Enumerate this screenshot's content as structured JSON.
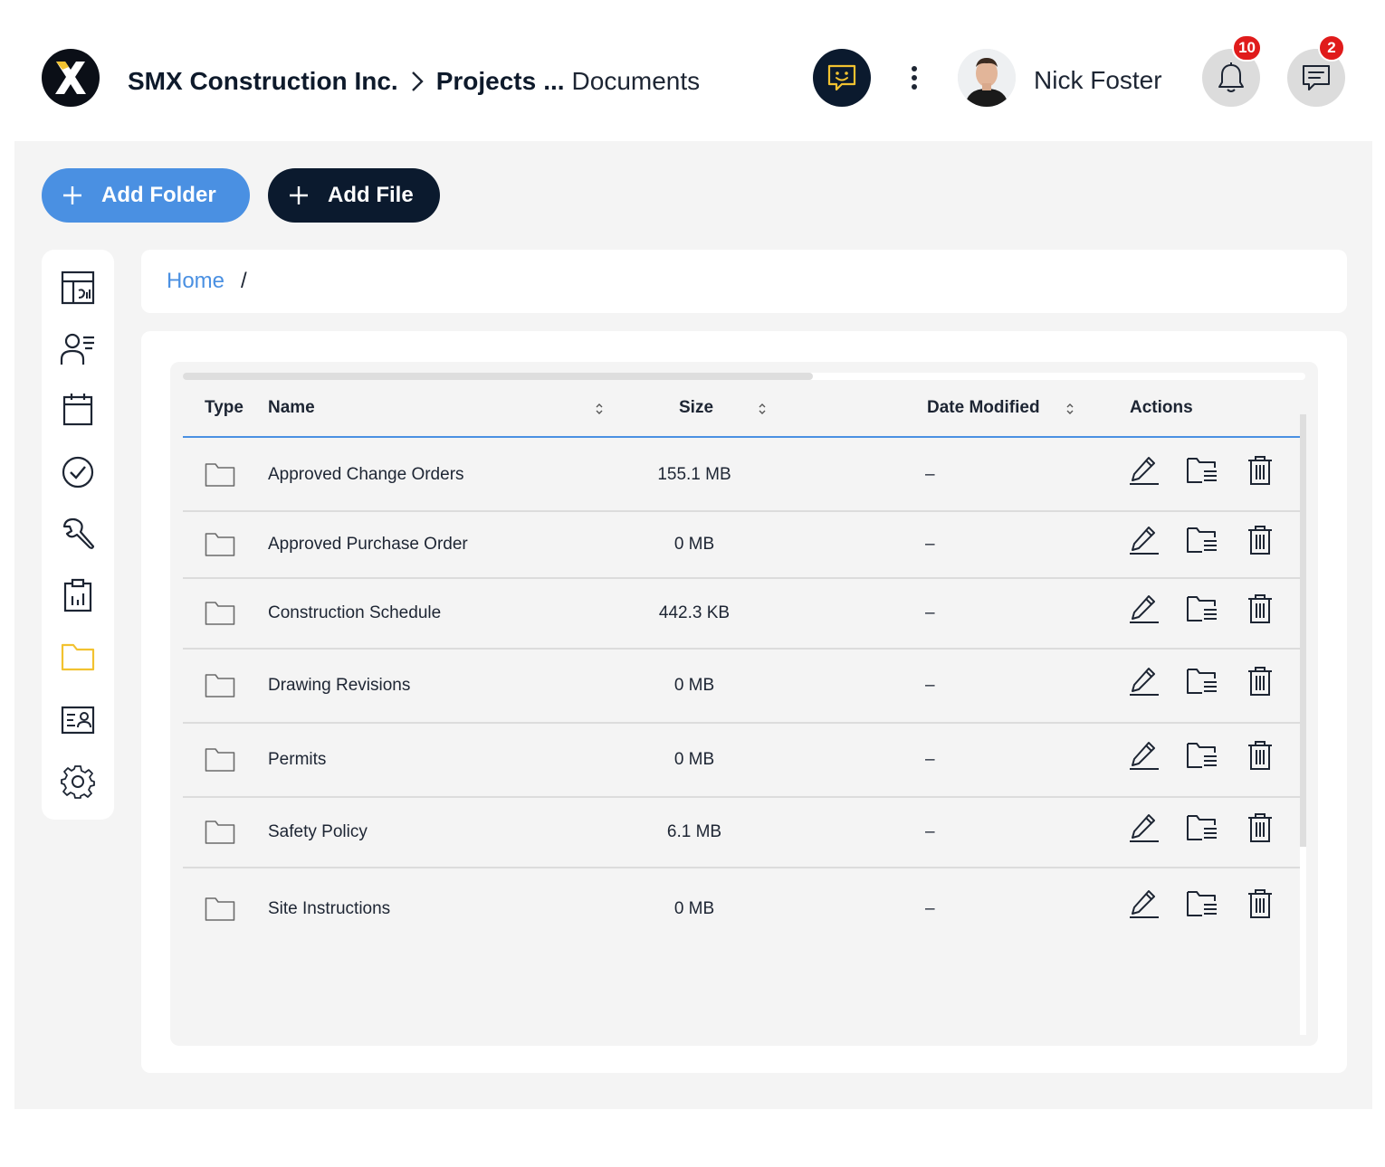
{
  "header": {
    "breadcrumb": {
      "company": "SMX Construction Inc.",
      "projects": "Projects",
      "ellipsis": "...",
      "current": "Documents"
    },
    "user": {
      "name": "Nick Foster"
    },
    "notifications": {
      "count": "10"
    },
    "messages": {
      "count": "2"
    }
  },
  "toolbar": {
    "add_folder_label": "Add Folder",
    "add_file_label": "Add File"
  },
  "sidebar": {
    "items": [
      {
        "icon": "dashboard-icon"
      },
      {
        "icon": "contacts-icon"
      },
      {
        "icon": "calendar-icon"
      },
      {
        "icon": "tasks-icon"
      },
      {
        "icon": "tools-icon"
      },
      {
        "icon": "reports-icon"
      },
      {
        "icon": "folder-icon",
        "active": true
      },
      {
        "icon": "id-card-icon"
      },
      {
        "icon": "settings-icon"
      }
    ]
  },
  "path": {
    "home": "Home",
    "separator": "/"
  },
  "table": {
    "columns": {
      "type": "Type",
      "name": "Name",
      "size": "Size",
      "date": "Date Modified",
      "actions": "Actions"
    },
    "rows": [
      {
        "name": "Approved Change Orders",
        "size": "155.1 MB",
        "date": "–"
      },
      {
        "name": "Approved Purchase Order",
        "size": "0 MB",
        "date": "–"
      },
      {
        "name": "Construction Schedule",
        "size": "442.3 KB",
        "date": "–"
      },
      {
        "name": "Drawing Revisions",
        "size": "0 MB",
        "date": "–"
      },
      {
        "name": "Permits",
        "size": "0 MB",
        "date": "–"
      },
      {
        "name": "Safety Policy",
        "size": "6.1 MB",
        "date": "–"
      },
      {
        "name": "Site Instructions",
        "size": "0 MB",
        "date": "–"
      }
    ]
  },
  "colors": {
    "accent": "#4a90e2",
    "dark": "#0b1a2e",
    "active_icon": "#f2c230",
    "badge": "#e01b1b"
  }
}
